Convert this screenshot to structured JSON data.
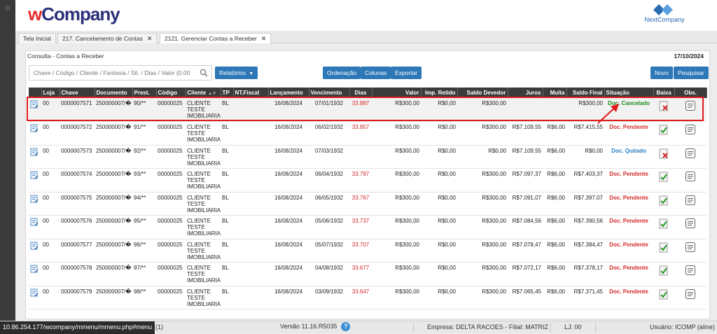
{
  "app": {
    "logo_w": "w",
    "logo_rest": "Company",
    "brand": "NextCompany",
    "home_icon": "home-icon"
  },
  "tabs": [
    {
      "label": "Tela Inicial",
      "closable": false
    },
    {
      "label": "217. Cancelamento de Contas",
      "closable": true
    },
    {
      "label": "2121. Gerenciar Contas a Receber",
      "closable": true
    }
  ],
  "tab_close_glyph": "✕",
  "panel": {
    "title": "Consulta - Contas a Receber",
    "date": "17/10/2024",
    "search_placeholder": "Chave / Código / Cliente / Fantasia / Sit. / Dias / Valor (0.00",
    "relatorios": "Relatórios",
    "ordenacao": "Ordenação",
    "colunas": "Colunas",
    "exportar": "Exportar",
    "novo": "Novo",
    "pesquisar": "Pesquisar"
  },
  "columns": [
    "",
    "Loja",
    "Chave",
    "Documento",
    "Prest.",
    "Código",
    "Cliente",
    "TP",
    "NT.Fiscal",
    "Lançamento",
    "Vencimento",
    "Dias",
    "Valor",
    "Imp. Retido",
    "Saldo Devedor",
    "Juros",
    "Multa",
    "Saldo Final",
    "Situação",
    "Baixa",
    "Obs."
  ],
  "rows": [
    {
      "loja": "00",
      "chave": "0000007571",
      "doc": "250000007/�",
      "prest": "90/**",
      "codigo": "00000025",
      "cliente": "CLIENTE TESTE IMOBILIARIA",
      "tp": "BL",
      "nf": "",
      "lanc": "16/08/2024",
      "venc": "07/01/1932",
      "dias": "33.887",
      "valor": "R$300,00",
      "imp": "R$0,00",
      "saldo_dev": "R$300,00",
      "juros": "",
      "multa": "",
      "saldo_final": "R$300,00",
      "situacao": "Doc. Cancelado",
      "status": "cancel",
      "baixa": "cancel"
    },
    {
      "loja": "00",
      "chave": "0000007572",
      "doc": "250000007/�",
      "prest": "91/**",
      "codigo": "00000025",
      "cliente": "CLIENTE TESTE IMOBILIARIA",
      "tp": "BL",
      "nf": "",
      "lanc": "16/08/2024",
      "venc": "06/02/1932",
      "dias": "33.857",
      "valor": "R$300,00",
      "imp": "R$0,00",
      "saldo_dev": "R$300,00",
      "juros": "R$7.109,55",
      "multa": "R$6,00",
      "saldo_final": "R$7.415,55",
      "situacao": "Doc. Pendente",
      "status": "pend",
      "baixa": "ok"
    },
    {
      "loja": "00",
      "chave": "0000007573",
      "doc": "250000007/�",
      "prest": "92/**",
      "codigo": "00000025",
      "cliente": "CLIENTE TESTE IMOBILIARIA",
      "tp": "BL",
      "nf": "",
      "lanc": "16/08/2024",
      "venc": "07/03/1932",
      "dias": "",
      "valor": "R$300,00",
      "imp": "R$0,00",
      "saldo_dev": "R$0,00",
      "juros": "R$7.109,55",
      "multa": "R$6,00",
      "saldo_final": "R$0,00",
      "situacao": "Doc. Quitado",
      "status": "paid",
      "baixa": "cancel"
    },
    {
      "loja": "00",
      "chave": "0000007574",
      "doc": "250000007/�",
      "prest": "93/**",
      "codigo": "00000025",
      "cliente": "CLIENTE TESTE IMOBILIARIA",
      "tp": "BL",
      "nf": "",
      "lanc": "16/08/2024",
      "venc": "06/04/1932",
      "dias": "33.797",
      "valor": "R$300,00",
      "imp": "R$0,00",
      "saldo_dev": "R$300,00",
      "juros": "R$7.097,37",
      "multa": "R$6,00",
      "saldo_final": "R$7.403,37",
      "situacao": "Doc. Pendente",
      "status": "pend",
      "baixa": "ok"
    },
    {
      "loja": "00",
      "chave": "0000007575",
      "doc": "250000007/�",
      "prest": "94/**",
      "codigo": "00000025",
      "cliente": "CLIENTE TESTE IMOBILIARIA",
      "tp": "BL",
      "nf": "",
      "lanc": "16/08/2024",
      "venc": "06/05/1932",
      "dias": "33.767",
      "valor": "R$300,00",
      "imp": "R$0,00",
      "saldo_dev": "R$300,00",
      "juros": "R$7.091,07",
      "multa": "R$6,00",
      "saldo_final": "R$7.397,07",
      "situacao": "Doc. Pendente",
      "status": "pend",
      "baixa": "ok"
    },
    {
      "loja": "00",
      "chave": "0000007576",
      "doc": "250000007/�",
      "prest": "95/**",
      "codigo": "00000025",
      "cliente": "CLIENTE TESTE IMOBILIARIA",
      "tp": "BL",
      "nf": "",
      "lanc": "16/08/2024",
      "venc": "05/06/1932",
      "dias": "33.737",
      "valor": "R$300,00",
      "imp": "R$0,00",
      "saldo_dev": "R$300,00",
      "juros": "R$7.084,56",
      "multa": "R$6,00",
      "saldo_final": "R$7.390,56",
      "situacao": "Doc. Pendente",
      "status": "pend",
      "baixa": "ok"
    },
    {
      "loja": "00",
      "chave": "0000007577",
      "doc": "250000007/�",
      "prest": "96/**",
      "codigo": "00000025",
      "cliente": "CLIENTE TESTE IMOBILIARIA",
      "tp": "BL",
      "nf": "",
      "lanc": "16/08/2024",
      "venc": "05/07/1932",
      "dias": "33.707",
      "valor": "R$300,00",
      "imp": "R$0,00",
      "saldo_dev": "R$300,00",
      "juros": "R$7.078,47",
      "multa": "R$6,00",
      "saldo_final": "R$7.384,47",
      "situacao": "Doc. Pendente",
      "status": "pend",
      "baixa": "ok"
    },
    {
      "loja": "00",
      "chave": "0000007578",
      "doc": "250000007/�",
      "prest": "97/**",
      "codigo": "00000025",
      "cliente": "CLIENTE TESTE IMOBILIARIA",
      "tp": "BL",
      "nf": "",
      "lanc": "16/08/2024",
      "venc": "04/08/1932",
      "dias": "33.677",
      "valor": "R$300,00",
      "imp": "R$0,00",
      "saldo_dev": "R$300,00",
      "juros": "R$7.072,17",
      "multa": "R$6,00",
      "saldo_final": "R$7.378,17",
      "situacao": "Doc. Pendente",
      "status": "pend",
      "baixa": "ok"
    },
    {
      "loja": "00",
      "chave": "0000007579",
      "doc": "250000007/�",
      "prest": "98/**",
      "codigo": "00000025",
      "cliente": "CLIENTE TESTE IMOBILIARIA",
      "tp": "BL",
      "nf": "",
      "lanc": "16/08/2024",
      "venc": "03/09/1932",
      "dias": "33.647",
      "valor": "R$300,00",
      "imp": "R$0,00",
      "saldo_dev": "R$300,00",
      "juros": "R$7.065,45",
      "multa": "R$6,00",
      "saldo_final": "R$7.371,45",
      "situacao": "Doc. Pendente",
      "status": "pend",
      "baixa": "ok"
    }
  ],
  "statusbar": {
    "url": "10.86.254.177/wcompany/mmenu/mmenu.php#menu",
    "count": "(1)",
    "versao": "Versão 11.16.R5035",
    "help": "?",
    "empresa": "Empresa: DELTA RACOES - Filial: MATRIZ",
    "lj": "LJ: 00",
    "usuario": "Usuário: ICOMP (aline)"
  },
  "colors": {
    "accent": "#2f78b8",
    "header_dark": "#3b3b3b",
    "pending": "#d42a2a",
    "cancelled": "#1b8a1b",
    "paid": "#2a80c4",
    "highlight": "#e01b1b"
  }
}
